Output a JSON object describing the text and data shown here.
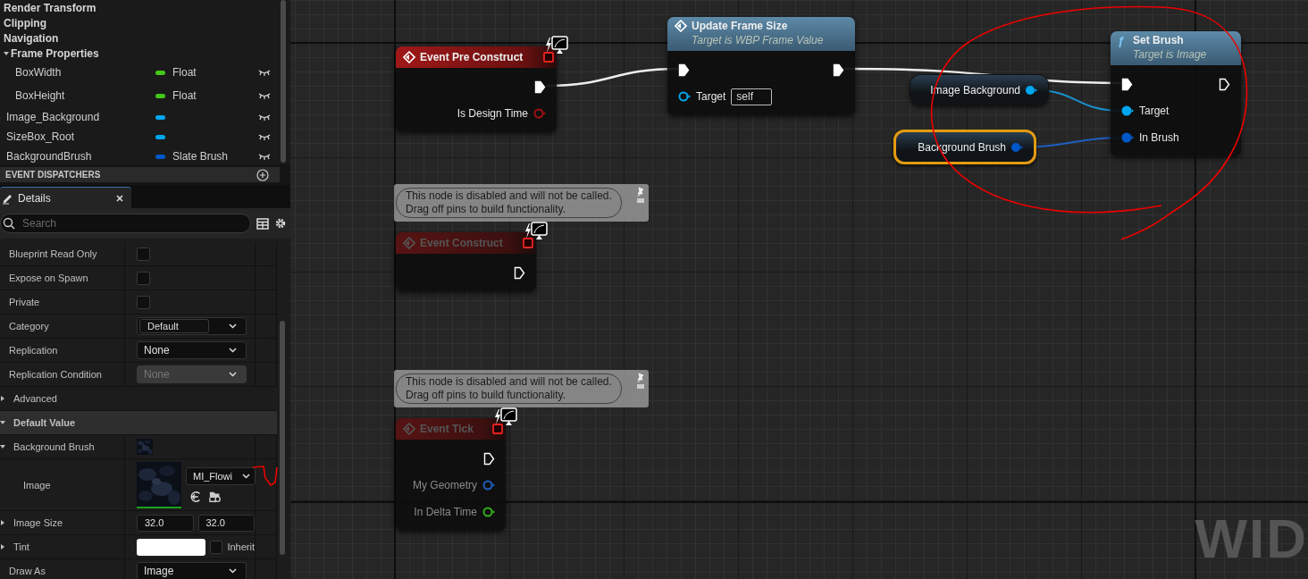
{
  "my_blueprint": {
    "items": [
      {
        "kind": "category",
        "label": "Render Transform"
      },
      {
        "kind": "category",
        "label": "Clipping"
      },
      {
        "kind": "category",
        "label": "Navigation"
      },
      {
        "kind": "category",
        "label": "Frame Properties",
        "children": [
          {
            "kind": "variable",
            "name": "BoxWidth",
            "color": "#43c81a",
            "type": "Float"
          },
          {
            "kind": "variable",
            "name": "BoxHeight",
            "color": "#43c81a",
            "type": "Float"
          }
        ]
      },
      {
        "kind": "variable",
        "name": "Image_Background",
        "color": "#00a7f0"
      },
      {
        "kind": "variable",
        "name": "SizeBox_Root",
        "color": "#00a7f0"
      },
      {
        "kind": "variable",
        "name": "BackgroundBrush",
        "color": "#0058c8",
        "type": "Slate Brush"
      }
    ],
    "section": "EVENT DISPATCHERS"
  },
  "details": {
    "tab": "Details",
    "search_placeholder": "Search",
    "rows": [
      {
        "kind": "checkbox",
        "label": "Blueprint Read Only",
        "checked": false
      },
      {
        "kind": "checkbox",
        "label": "Expose on Spawn",
        "checked": false
      },
      {
        "kind": "checkbox",
        "label": "Private",
        "checked": false
      },
      {
        "kind": "combo",
        "label": "Category",
        "value": "Default"
      },
      {
        "kind": "dropdown",
        "label": "Replication",
        "value": "None",
        "disabled": false
      },
      {
        "kind": "dropdown",
        "label": "Replication Condition",
        "value": "None",
        "disabled": true
      },
      {
        "kind": "section",
        "label": "Advanced",
        "expanded": false
      },
      {
        "kind": "category",
        "label": "Default Value",
        "expanded": true
      },
      {
        "kind": "brush",
        "label": "Background Brush",
        "expanded": true
      },
      {
        "label": "Image",
        "value": "MI_Flowi"
      },
      {
        "kind": "vector",
        "label": "Image Size",
        "expanded": false,
        "values": [
          "32.0",
          "32.0"
        ]
      },
      {
        "kind": "color",
        "label": "Tint",
        "expanded": false,
        "color": "#ffffff",
        "inherit_label": "Inherit",
        "inherit_checked": false
      },
      {
        "kind": "dropdown",
        "label": "Draw As",
        "value": "Image",
        "disabled": false
      }
    ]
  },
  "graph": {
    "nodes": [
      {
        "kind": "event",
        "title": "Event Pre Construct",
        "disabled": false,
        "pins": [
          {
            "kind": "exec",
            "connected": true
          },
          {
            "kind": "data",
            "output": true,
            "label": "Is Design Time",
            "color": "#a01010",
            "connected": false
          }
        ]
      },
      {
        "kind": "function",
        "title": "Update Frame Size",
        "subtitle": "Target is WBP Frame Value",
        "disabled": false,
        "pins": [
          {
            "kind": "exec",
            "connected": true
          },
          {
            "kind": "exec",
            "connected": true
          },
          {
            "kind": "data",
            "output": false,
            "label": "Target",
            "color": "#00a7f0",
            "connected": false,
            "default": "self"
          }
        ]
      },
      {
        "kind": "getter",
        "label": "Image Background",
        "color": "#00a7f0",
        "selected": false
      },
      {
        "kind": "getter",
        "label": "Background Brush",
        "color": "#0058c8",
        "selected": true
      },
      {
        "kind": "function",
        "title": "Set Brush",
        "glyph": "ƒ",
        "subtitle": "Target is Image",
        "disabled": false,
        "pins": [
          {
            "kind": "exec",
            "connected": true
          },
          {
            "kind": "exec",
            "connected": false
          },
          {
            "kind": "data",
            "output": false,
            "label": "Target",
            "color": "#00a7f0",
            "connected": true
          },
          {
            "kind": "data",
            "output": false,
            "label": "In Brush",
            "color": "#0058c8",
            "connected": true
          }
        ]
      },
      {
        "kind": "event",
        "title": "Event Construct",
        "disabled": true,
        "comment": "This node is disabled and will not be called.\nDrag off pins to build functionality.",
        "pins": [
          {
            "kind": "exec",
            "connected": false
          }
        ]
      },
      {
        "kind": "event",
        "title": "Event Tick",
        "disabled": true,
        "comment": "This node is disabled and will not be called.\nDrag off pins to build functionality.",
        "pins": [
          {
            "kind": "exec",
            "connected": false
          },
          {
            "kind": "data",
            "output": true,
            "label": "My Geometry",
            "color": "#1f5fc0",
            "connected": false
          },
          {
            "kind": "data",
            "output": true,
            "label": "In Delta Time",
            "color": "#34b01a",
            "connected": false
          }
        ]
      }
    ],
    "corner_label": "WID"
  }
}
